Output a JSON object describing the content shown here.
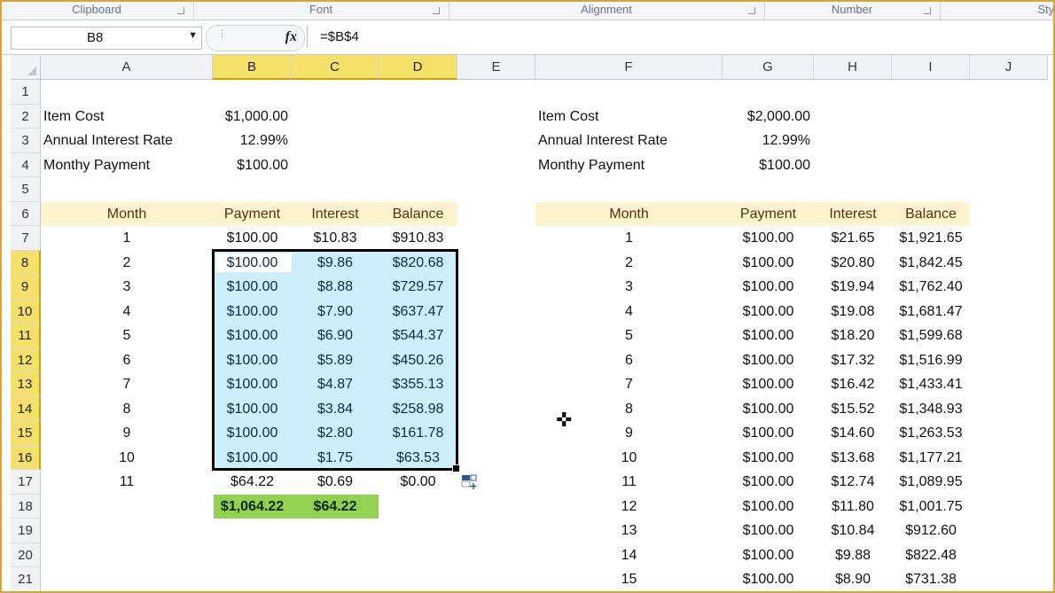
{
  "ribbon": {
    "groups": [
      "Clipboard",
      "Font",
      "Alignment",
      "Number",
      "Styl"
    ]
  },
  "formula_bar": {
    "name_box": "B8",
    "formula": "=$B$4"
  },
  "columns": [
    "A",
    "B",
    "C",
    "D",
    "E",
    "F",
    "G",
    "H",
    "I",
    "J"
  ],
  "rows": [
    "1",
    "2",
    "3",
    "4",
    "5",
    "6",
    "7",
    "8",
    "9",
    "10",
    "11",
    "12",
    "13",
    "14",
    "15",
    "16",
    "17",
    "18",
    "19",
    "20",
    "21"
  ],
  "left_block": {
    "params": [
      {
        "label": "Item Cost",
        "value": "$1,000.00"
      },
      {
        "label": "Annual Interest Rate",
        "value": "12.99%"
      },
      {
        "label": "Monthy Payment",
        "value": "$100.00"
      }
    ],
    "headers": [
      "Month",
      "Payment",
      "Interest",
      "Balance"
    ],
    "table": [
      [
        "1",
        "$100.00",
        "$10.83",
        "$910.83"
      ],
      [
        "2",
        "$100.00",
        "$9.86",
        "$820.68"
      ],
      [
        "3",
        "$100.00",
        "$8.88",
        "$729.57"
      ],
      [
        "4",
        "$100.00",
        "$7.90",
        "$637.47"
      ],
      [
        "5",
        "$100.00",
        "$6.90",
        "$544.37"
      ],
      [
        "6",
        "$100.00",
        "$5.89",
        "$450.26"
      ],
      [
        "7",
        "$100.00",
        "$4.87",
        "$355.13"
      ],
      [
        "8",
        "$100.00",
        "$3.84",
        "$258.98"
      ],
      [
        "9",
        "$100.00",
        "$2.80",
        "$161.78"
      ],
      [
        "10",
        "$100.00",
        "$1.75",
        "$63.53"
      ],
      [
        "11",
        "$64.22",
        "$0.69",
        "$0.00"
      ]
    ],
    "totals": [
      "$1,064.22",
      "$64.22"
    ]
  },
  "right_block": {
    "params": [
      {
        "label": "Item Cost",
        "value": "$2,000.00"
      },
      {
        "label": "Annual Interest Rate",
        "value": "12.99%"
      },
      {
        "label": "Monthy Payment",
        "value": "$100.00"
      }
    ],
    "headers": [
      "Month",
      "Payment",
      "Interest",
      "Balance"
    ],
    "table": [
      [
        "1",
        "$100.00",
        "$21.65",
        "$1,921.65"
      ],
      [
        "2",
        "$100.00",
        "$20.80",
        "$1,842.45"
      ],
      [
        "3",
        "$100.00",
        "$19.94",
        "$1,762.40"
      ],
      [
        "4",
        "$100.00",
        "$19.08",
        "$1,681.47"
      ],
      [
        "5",
        "$100.00",
        "$18.20",
        "$1,599.68"
      ],
      [
        "6",
        "$100.00",
        "$17.32",
        "$1,516.99"
      ],
      [
        "7",
        "$100.00",
        "$16.42",
        "$1,433.41"
      ],
      [
        "8",
        "$100.00",
        "$15.52",
        "$1,348.93"
      ],
      [
        "9",
        "$100.00",
        "$14.60",
        "$1,263.53"
      ],
      [
        "10",
        "$100.00",
        "$13.68",
        "$1,177.21"
      ],
      [
        "11",
        "$100.00",
        "$12.74",
        "$1,089.95"
      ],
      [
        "12",
        "$100.00",
        "$11.80",
        "$1,001.75"
      ],
      [
        "13",
        "$100.00",
        "$10.84",
        "$912.60"
      ],
      [
        "14",
        "$100.00",
        "$9.88",
        "$822.48"
      ],
      [
        "15",
        "$100.00",
        "$8.90",
        "$731.38"
      ]
    ]
  },
  "colors": {
    "selection_fill": "#cdeffc",
    "header_band": "#fdf3cf",
    "total_fill": "#92d050",
    "selected_header": "#f6e06a"
  }
}
